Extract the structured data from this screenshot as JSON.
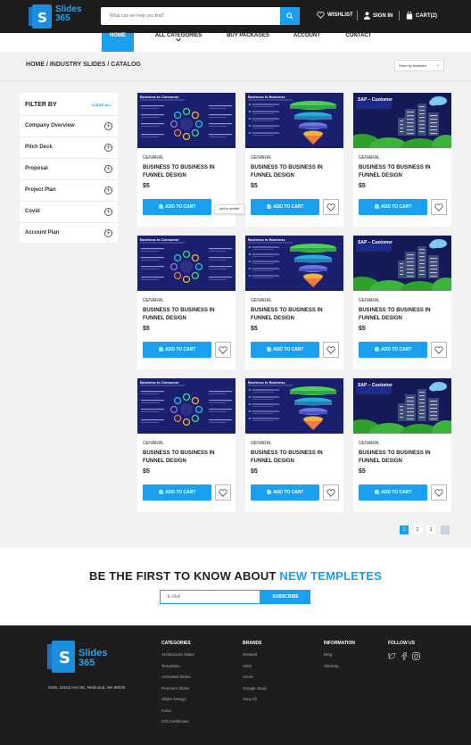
{
  "header": {
    "logo_line1": "Slides",
    "logo_line2": "365",
    "logo_letter": "S",
    "search_placeholder": "What can we help you find?",
    "wishlist": "WISHLIST",
    "signin": "SIGN IN",
    "cart": "CART(2)"
  },
  "nav": {
    "home": "HOME",
    "categories": "ALL CATEGORIES",
    "packages": "BUY PACKAGES",
    "account": "ACCOUNT",
    "contact": "CONTACT"
  },
  "breadcrumb": "HOME / INDUSTRY SLIDES / CATALOG",
  "sort": {
    "label": "Short by featured"
  },
  "filter": {
    "title": "FILTER BY",
    "clear": "CLEAR ALL",
    "items": [
      "Company Overview",
      "Pitch Deck",
      "Proposal",
      "Project Plan",
      "Covid",
      "Account Plan"
    ]
  },
  "products": [
    {
      "thumb": "Business to Consumer",
      "category": "GENARAL",
      "name": "BUSINESS TO BUSINESS IN FUNNEL DESIGN",
      "price": "$5",
      "add": "ADD TO CART"
    },
    {
      "thumb": "Business to Business",
      "category": "GENARAL",
      "name": "BUSINESS TO BUSINESS IN FUNNEL DESIGN",
      "price": "$5",
      "add": "ADD TO CART"
    },
    {
      "thumb": "SAP – Customer",
      "category": "GENARAL",
      "name": "BUSINESS TO BUSINESS IN FUNNEL DESIGN",
      "price": "$5",
      "add": "ADD TO CART"
    },
    {
      "thumb": "Business to Consumer",
      "category": "GENARAL",
      "name": "BUSINESS TO BUSINESS IN FUNNEL DESIGN",
      "price": "$5",
      "add": "ADD TO CART"
    },
    {
      "thumb": "Business to Business",
      "category": "GENARAL",
      "name": "BUSINESS TO BUSINESS IN FUNNEL DESIGN",
      "price": "$5",
      "add": "ADD TO CART"
    },
    {
      "thumb": "SAP – Customer",
      "category": "GENARAL",
      "name": "BUSINESS TO BUSINESS IN FUNNEL DESIGN",
      "price": "$5",
      "add": "ADD TO CART"
    },
    {
      "thumb": "Business to Consumer",
      "category": "GENARAL",
      "name": "BUSINESS TO BUSINESS IN FUNNEL DESIGN",
      "price": "$5",
      "add": "ADD TO CART"
    },
    {
      "thumb": "Business to Business",
      "category": "GENARAL",
      "name": "BUSINESS TO BUSINESS IN FUNNEL DESIGN",
      "price": "$5",
      "add": "ADD TO CART"
    },
    {
      "thumb": "SAP – Customer",
      "category": "GENARAL",
      "name": "BUSINESS TO BUSINESS IN FUNNEL DESIGN",
      "price": "$5",
      "add": "ADD TO CART"
    }
  ],
  "tooltip": "Add to wishlist",
  "pagination": {
    "pages": [
      "1",
      "2",
      "3"
    ],
    "next": "›",
    "current": "1"
  },
  "newsletter": {
    "title_part1": "BE THE FIRST TO KNOW ABOUT",
    "title_part2": "NEW TEMPLETES",
    "email_placeholder": "E-Mail",
    "subscribe": "SUBSCRIBE"
  },
  "footer": {
    "address": "2205, 152nd Ave NE, Redmond, WA 98029",
    "categories": {
      "title": "CATEGORIES",
      "links": [
        "Architecture slides",
        "Templates",
        "Animated Slides",
        "Premium Slides",
        "Slides Design",
        "Icons",
        "Gift Certificates"
      ]
    },
    "brands": {
      "title": "BRANDS",
      "links": [
        "General",
        "AWS",
        "Azure",
        "Google cloud",
        "View All"
      ]
    },
    "information": {
      "title": "INFORMATION",
      "links": [
        "Blog",
        "Sitemap"
      ]
    },
    "follow": {
      "title": "FOLLOW US",
      "icons": [
        "twitter-icon",
        "facebook-icon",
        "instagram-icon"
      ]
    }
  },
  "colors": {
    "accent": "#1aa0ef",
    "dark": "#1d1d1d",
    "thumb_bg": "#1a1f6e"
  }
}
